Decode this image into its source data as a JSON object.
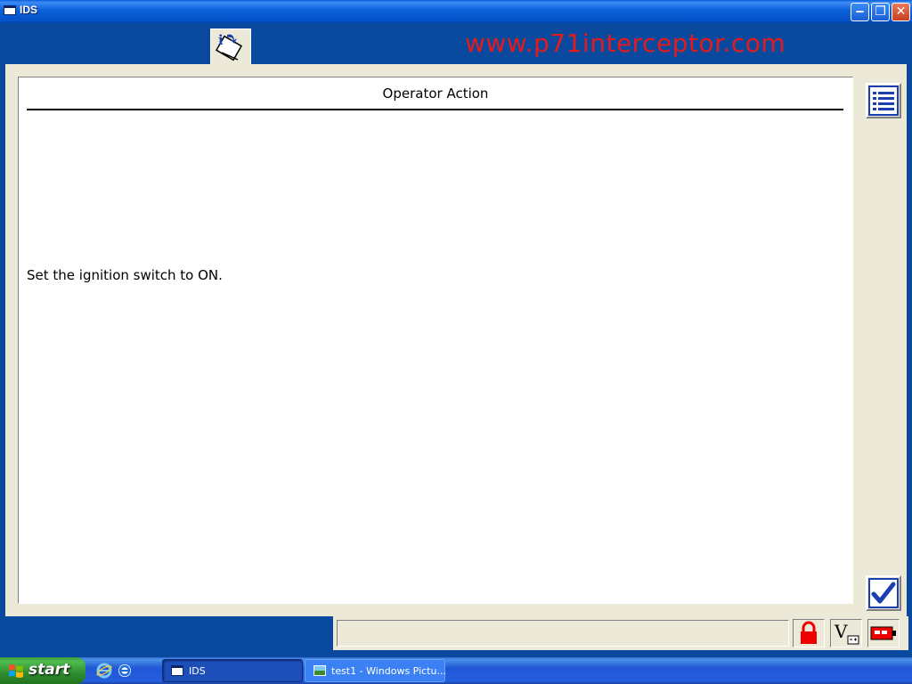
{
  "window": {
    "title": "IDS",
    "controls": {
      "minimize": "‒",
      "maximize": "❐",
      "close": "✕"
    }
  },
  "header": {
    "watermark": "www.p71interceptor.com",
    "tab_icon": "info-tool-icon"
  },
  "panel": {
    "title": "Operator Action",
    "instruction": "Set the ignition switch to ON."
  },
  "side_buttons": {
    "list": "list-icon",
    "confirm": "checkmark-icon"
  },
  "status_bar": {
    "text": "",
    "icons": [
      "lock-icon",
      "voltage-icon",
      "battery-icon"
    ]
  },
  "taskbar": {
    "start_label": "start",
    "tasks": [
      {
        "label": "IDS"
      },
      {
        "label": "test1 - Windows Pictu..."
      }
    ]
  },
  "colors": {
    "watermark": "#e51b1b",
    "accent": "#0a4a9e",
    "panel_bg": "#ece9d8"
  }
}
